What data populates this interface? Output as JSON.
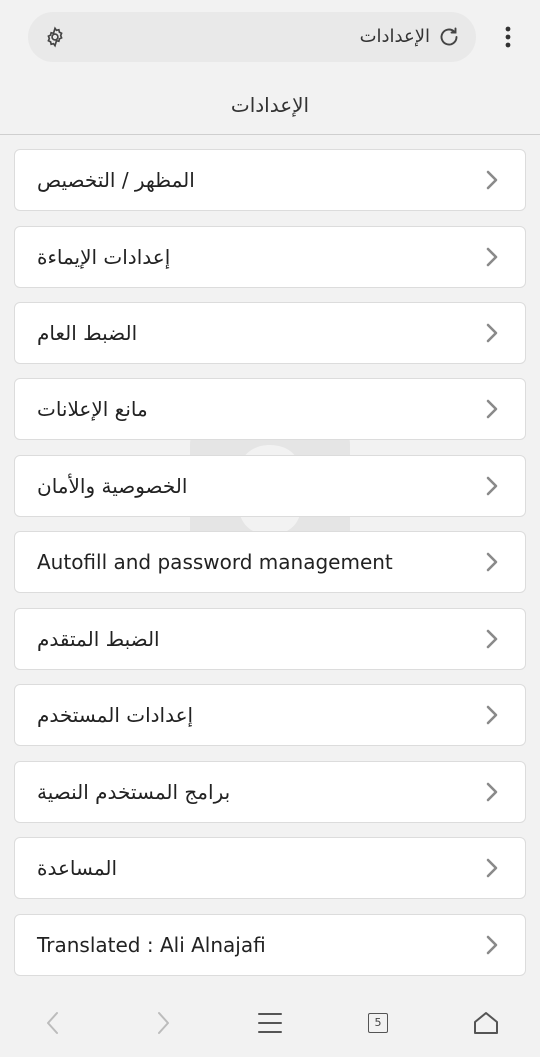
{
  "header": {
    "url_text": "الإعدادات",
    "icons": {
      "settings": "gear-icon",
      "reload": "reload-icon",
      "menu": "kebab-menu-icon"
    }
  },
  "page": {
    "title": "الإعدادات"
  },
  "settings_items": [
    {
      "label": "المظهر / التخصيص"
    },
    {
      "label": "إعدادات الإيماءة"
    },
    {
      "label": "الضبط العام"
    },
    {
      "label": "مانع الإعلانات"
    },
    {
      "label": "الخصوصية والأمان"
    },
    {
      "label": "Autofill and password management"
    },
    {
      "label": "الضبط المتقدم"
    },
    {
      "label": "إعدادات المستخدم"
    },
    {
      "label": "برامج المستخدم النصية"
    },
    {
      "label": "المساعدة"
    },
    {
      "label": "Translated : Ali Alnajafi"
    }
  ],
  "bottom_nav": {
    "tab_count": "5",
    "icons": {
      "back": "back-arrow-icon",
      "forward": "forward-arrow-icon",
      "menu": "hamburger-icon",
      "tabs": "tabs-icon",
      "home": "home-icon"
    }
  },
  "colors": {
    "background": "#f2f2f2",
    "card": "#ffffff",
    "border": "#dcdcdc",
    "chevron": "#8a8a8a"
  }
}
